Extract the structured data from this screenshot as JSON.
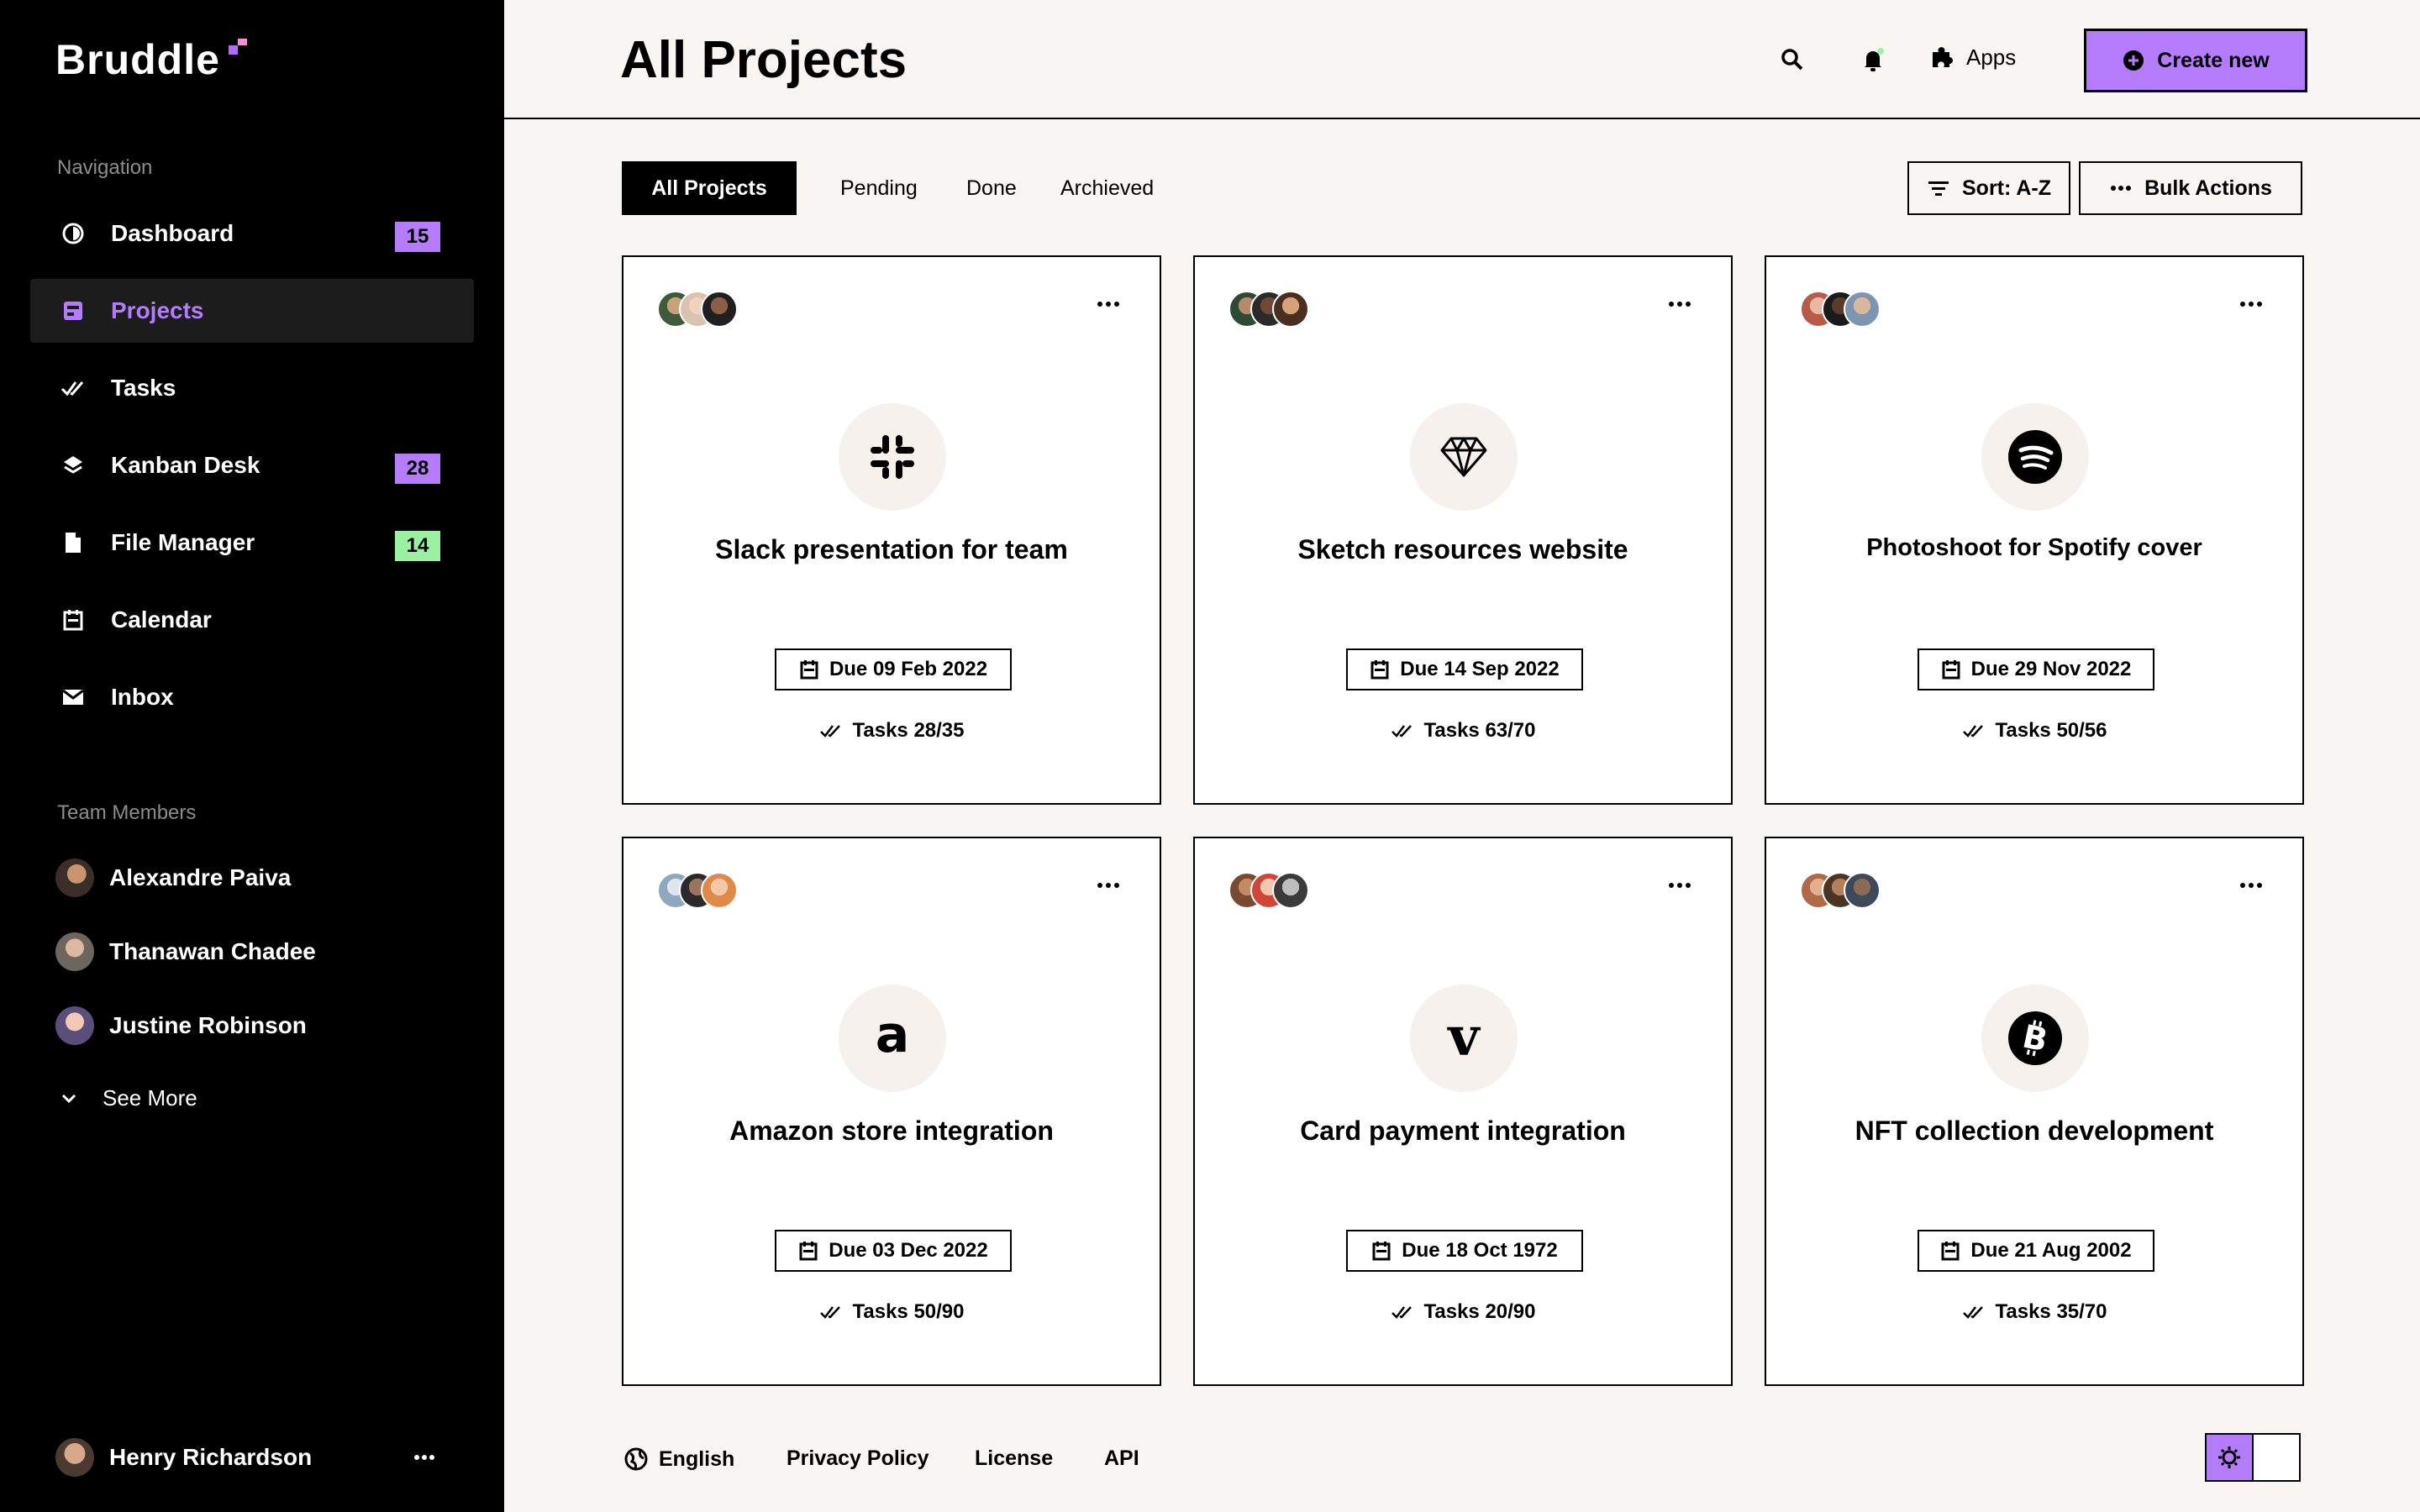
{
  "app": {
    "name": "Bruddle"
  },
  "sidebar": {
    "nav_title": "Navigation",
    "items": [
      {
        "label": "Dashboard",
        "badge": "15",
        "badge_color": "#b47cfb"
      },
      {
        "label": "Projects",
        "badge": "",
        "active": true
      },
      {
        "label": "Tasks",
        "badge": ""
      },
      {
        "label": "Kanban Desk",
        "badge": "28",
        "badge_color": "#b47cfb"
      },
      {
        "label": "File Manager",
        "badge": "14",
        "badge_color": "#9cf0a4"
      },
      {
        "label": "Calendar",
        "badge": ""
      },
      {
        "label": "Inbox",
        "badge": ""
      }
    ],
    "team_title": "Team Members",
    "members": [
      {
        "name": "Alexandre Paiva"
      },
      {
        "name": "Thanawan Chadee"
      },
      {
        "name": "Justine Robinson"
      }
    ],
    "see_more": "See More",
    "current_user": "Henry Richardson"
  },
  "header": {
    "title": "All Projects",
    "apps_label": "Apps",
    "create_label": "Create new"
  },
  "toolbar": {
    "tabs": [
      "All Projects",
      "Pending",
      "Done",
      "Archieved"
    ],
    "sort_label": "Sort: A-Z",
    "bulk_label": "Bulk Actions"
  },
  "projects": [
    {
      "title": "Slack presentation for team",
      "due": "Due 09 Feb 2022",
      "tasks": "Tasks 28/35",
      "icon": "slack-icon"
    },
    {
      "title": "Sketch resources website",
      "due": "Due 14 Sep 2022",
      "tasks": "Tasks 63/70",
      "icon": "sketch-icon"
    },
    {
      "title": "Photoshoot for Spotify cover",
      "due": "Due 29 Nov 2022",
      "tasks": "Tasks 50/56",
      "icon": "spotify-icon"
    },
    {
      "title": "Amazon store integration",
      "due": "Due 03 Dec 2022",
      "tasks": "Tasks 50/90",
      "icon": "amazon-icon"
    },
    {
      "title": "Card payment integration",
      "due": "Due 18 Oct 1972",
      "tasks": "Tasks 20/90",
      "icon": "venmo-icon"
    },
    {
      "title": "NFT collection development",
      "due": "Due 21 Aug 2002",
      "tasks": "Tasks 35/70",
      "icon": "bitcoin-icon"
    }
  ],
  "footer": {
    "language": "English",
    "privacy": "Privacy Policy",
    "license": "License",
    "api": "API"
  },
  "colors": {
    "accent": "#b47cfb",
    "green": "#9cf0a4",
    "background": "#f9f5f2"
  }
}
